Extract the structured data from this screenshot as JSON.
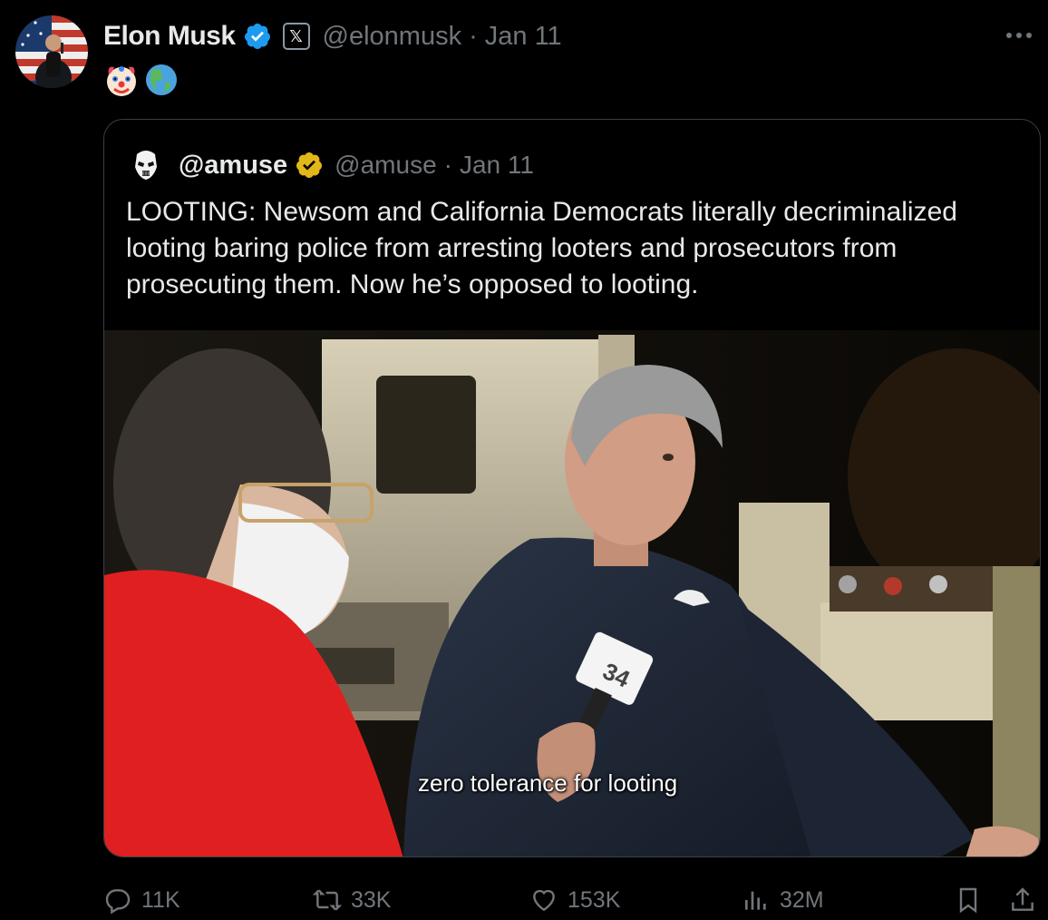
{
  "tweet": {
    "author_name": "Elon Musk",
    "x_badge": "𝕏",
    "handle": "@elonmusk",
    "separator": "·",
    "date": "Jan 11",
    "emojis": [
      "🤡",
      "🌎"
    ]
  },
  "quoted": {
    "author_name": "@amuse",
    "handle": "@amuse",
    "separator": "·",
    "date": "Jan 11",
    "text": "LOOTING: Newsom and California Democrats literally decriminalized looting baring police from arresting looters and prosecutors from prosecuting them. Now he’s opposed to looting.",
    "video_subtitle": "zero tolerance for looting",
    "mic_flag": "34"
  },
  "metrics": {
    "replies": "11K",
    "reposts": "33K",
    "likes": "153K",
    "views": "32M"
  },
  "icons": {
    "verified_owner": "verified-badge-icon",
    "verified_quoted": "gold-verified-badge-icon",
    "more": "more-icon",
    "reply": "reply-icon",
    "repost": "repost-icon",
    "like": "heart-icon",
    "views": "views-icon",
    "bookmark": "bookmark-icon",
    "share": "share-icon"
  },
  "colors": {
    "background": "#000000",
    "text": "#e7e9ea",
    "muted": "#71767b",
    "verified_blue": "#1d9bf0",
    "verified_gold": "#e2b719",
    "border": "#3a3f44"
  }
}
